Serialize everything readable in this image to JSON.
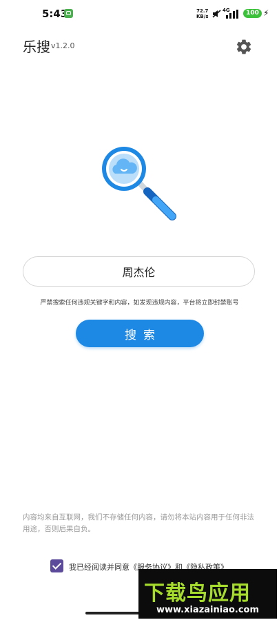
{
  "status_bar": {
    "time": "5:43",
    "net_speed_value": "72.7",
    "net_speed_unit": "KB/s",
    "network": "4G",
    "battery": "100"
  },
  "header": {
    "title": "乐搜",
    "version": "v1.2.0"
  },
  "search": {
    "value": "周杰伦",
    "notice": "严禁搜索任何违规关键字和内容，如发现违规内容，平台将立即封禁账号",
    "button_label": "搜索"
  },
  "disclaimer": "内容均来自互联网，我们不存储任何内容，请勿将本站内容用于任何非法用途，否则后果自负。",
  "agreement": {
    "checked": true,
    "text": "我已经阅读并同意《服务协议》和《隐私政策》"
  },
  "watermark": {
    "title": "下载鸟应用",
    "url": "www.xiazainiao.com"
  },
  "colors": {
    "primary": "#1e88e5",
    "checkbox": "#5b4b9a",
    "battery": "#3cc13b",
    "watermark_green": "#a6dc2c"
  }
}
